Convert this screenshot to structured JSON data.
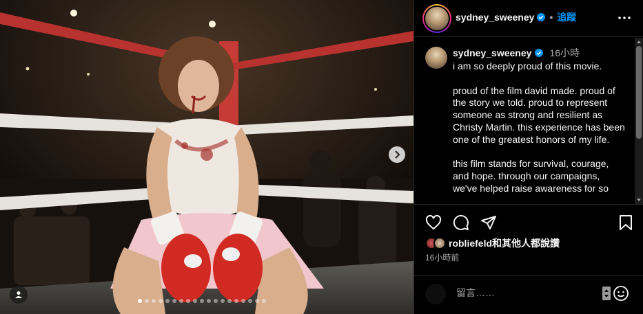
{
  "header": {
    "username": "sydney_sweeney",
    "bullet": "•",
    "follow_label": "追蹤"
  },
  "caption": {
    "username": "sydney_sweeney",
    "time": "16小時",
    "paragraphs": [
      "i am so deeply proud of this movie.",
      "proud of the film david made. proud of the story we told. proud to represent someone as strong and resilient as Christy Martin. this experience has been one of the greatest honors of my life.",
      "this film stands for survival, courage, and hope. through our campaigns, we've helped raise awareness for so"
    ]
  },
  "likes": {
    "text": "robliefeld和其他人都說讚"
  },
  "post_time": "16小時前",
  "comment": {
    "placeholder": "留言……"
  },
  "carousel": {
    "total": 19,
    "active_index": 0
  },
  "icons": {
    "verified": "verified-badge-icon",
    "more": "more-options-icon",
    "like": "heart-icon",
    "comment": "comment-icon",
    "share": "share-icon",
    "save": "bookmark-icon",
    "next": "chevron-right-icon",
    "tag": "user-tag-icon",
    "emoji": "smile-icon"
  },
  "colors": {
    "accent": "#0095f6",
    "verified": "#0095f6",
    "secondary_text": "#a8a8a8"
  }
}
